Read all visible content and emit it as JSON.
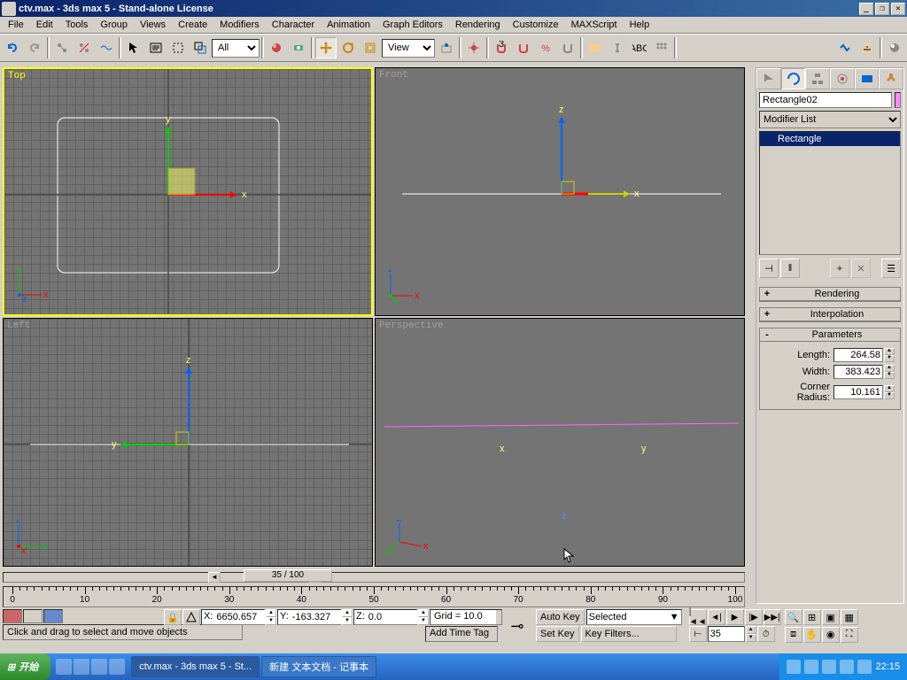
{
  "window": {
    "title": "ctv.max - 3ds max 5 - Stand-alone License"
  },
  "menu": [
    "File",
    "Edit",
    "Tools",
    "Group",
    "Views",
    "Create",
    "Modifiers",
    "Character",
    "Animation",
    "Graph Editors",
    "Rendering",
    "Customize",
    "MAXScript",
    "Help"
  ],
  "toolbar": {
    "dropdown_all": "All",
    "dropdown_view": "View"
  },
  "viewports": {
    "top": "Top",
    "front": "Front",
    "left": "Left",
    "perspective": "Perspective"
  },
  "cmdpanel": {
    "object_name": "Rectangle02",
    "color": "#ff88ff",
    "modifier_list_label": "Modifier List",
    "stack_item": "Rectangle",
    "rollouts": {
      "rendering": "Rendering",
      "interpolation": "Interpolation",
      "parameters": "Parameters"
    },
    "params": {
      "length_label": "Length:",
      "length": "264.58",
      "width_label": "Width:",
      "width": "383.423",
      "corner_label": "Corner Radius:",
      "corner": "10.161"
    }
  },
  "timeline": {
    "slider_text": "35 / 100",
    "ticks": [
      0,
      10,
      20,
      30,
      40,
      50,
      60,
      70,
      80,
      90,
      100
    ]
  },
  "status": {
    "prompt": "Click and drag to select and move objects",
    "x": "6650.657",
    "y": "-163.327",
    "z": "0.0",
    "grid": "Grid = 10.0",
    "add_tag": "Add Time Tag",
    "auto_key": "Auto Key",
    "set_key": "Set Key",
    "selected": "Selected",
    "key_filters": "Key Filters...",
    "frame": "35"
  },
  "taskbar": {
    "start": "开始",
    "task1": "ctv.max - 3ds max 5 - St...",
    "task2": "新建 文本文档 - 记事本",
    "clock": "22:15"
  }
}
